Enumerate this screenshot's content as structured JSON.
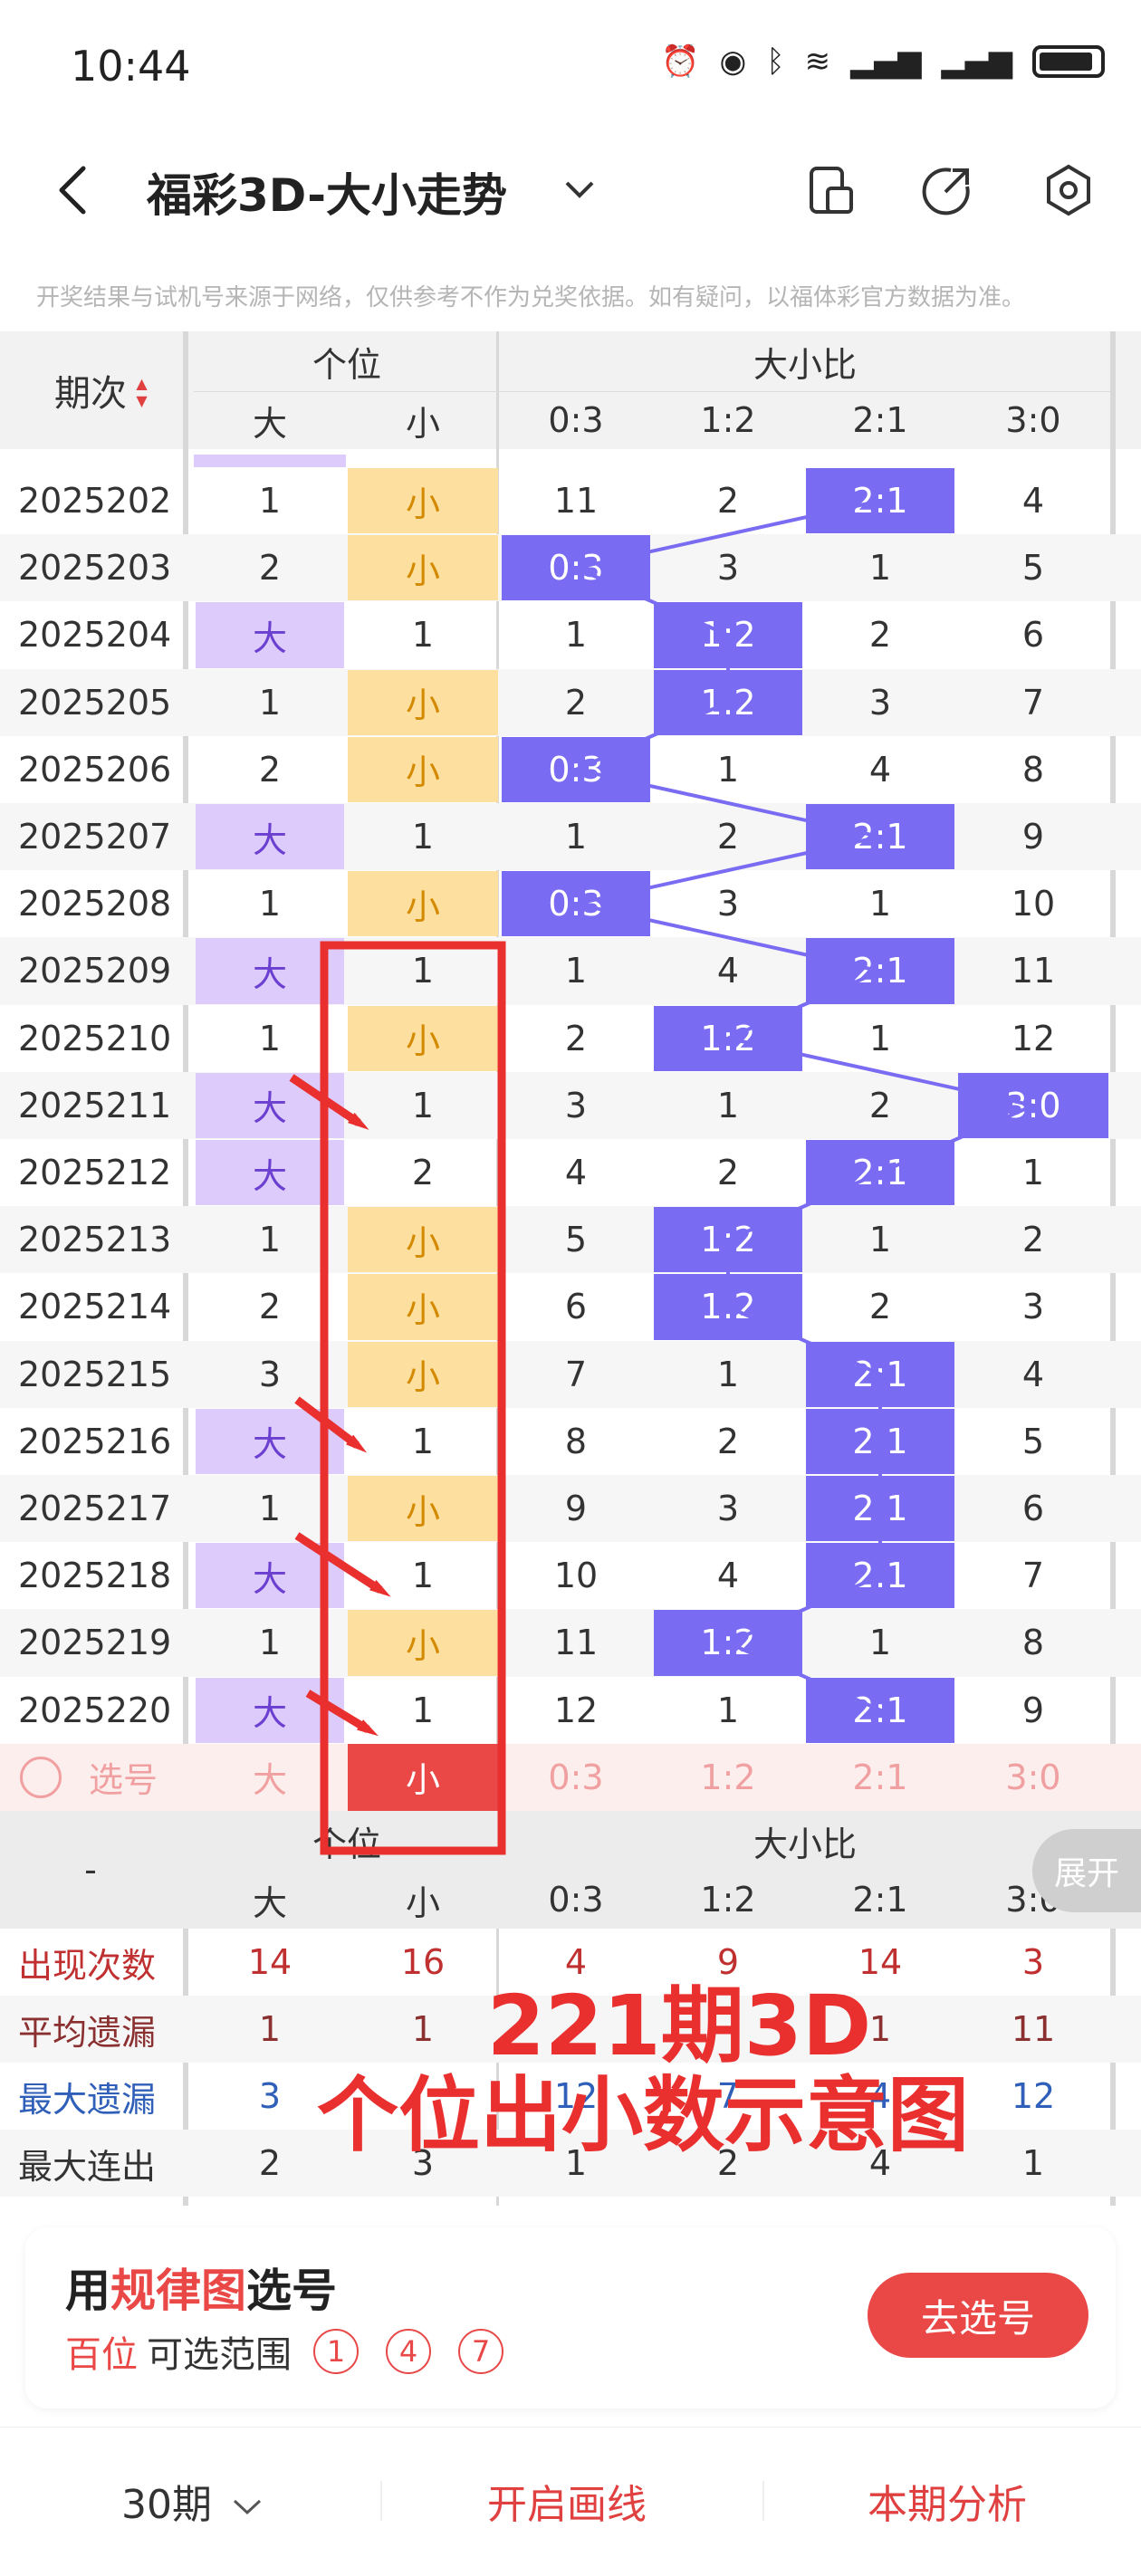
{
  "status_bar": {
    "time": "10:44"
  },
  "nav": {
    "title": "福彩3D-大小走势"
  },
  "disclaimer": "开奖结果与试机号来源于网络，仅供参考不作为兑奖依据。如有疑问，以福体彩官方数据为准。",
  "table": {
    "period_header": "期次",
    "group_single": "个位",
    "group_ratio": "大小比",
    "sub_headers": [
      "大",
      "小",
      "0:3",
      "1:2",
      "2:1",
      "3:0"
    ],
    "rows": [
      {
        "period": "2025202",
        "big": "1",
        "small": "小",
        "r03": "11",
        "r12": "2",
        "r21": "2:1",
        "r30": "4",
        "hit": "small",
        "ratio_hit": "r21"
      },
      {
        "period": "2025203",
        "big": "2",
        "small": "小",
        "r03": "0:3",
        "r12": "3",
        "r21": "1",
        "r30": "5",
        "hit": "small",
        "ratio_hit": "r03"
      },
      {
        "period": "2025204",
        "big": "大",
        "small": "1",
        "r03": "1",
        "r12": "1:2",
        "r21": "2",
        "r30": "6",
        "hit": "big",
        "ratio_hit": "r12"
      },
      {
        "period": "2025205",
        "big": "1",
        "small": "小",
        "r03": "2",
        "r12": "1:2",
        "r21": "3",
        "r30": "7",
        "hit": "small",
        "ratio_hit": "r12"
      },
      {
        "period": "2025206",
        "big": "2",
        "small": "小",
        "r03": "0:3",
        "r12": "1",
        "r21": "4",
        "r30": "8",
        "hit": "small",
        "ratio_hit": "r03"
      },
      {
        "period": "2025207",
        "big": "大",
        "small": "1",
        "r03": "1",
        "r12": "2",
        "r21": "2:1",
        "r30": "9",
        "hit": "big",
        "ratio_hit": "r21"
      },
      {
        "period": "2025208",
        "big": "1",
        "small": "小",
        "r03": "0:3",
        "r12": "3",
        "r21": "1",
        "r30": "10",
        "hit": "small",
        "ratio_hit": "r03"
      },
      {
        "period": "2025209",
        "big": "大",
        "small": "1",
        "r03": "1",
        "r12": "4",
        "r21": "2:1",
        "r30": "11",
        "hit": "big",
        "ratio_hit": "r21"
      },
      {
        "period": "2025210",
        "big": "1",
        "small": "小",
        "r03": "2",
        "r12": "1:2",
        "r21": "1",
        "r30": "12",
        "hit": "small",
        "ratio_hit": "r12"
      },
      {
        "period": "2025211",
        "big": "大",
        "small": "1",
        "r03": "3",
        "r12": "1",
        "r21": "2",
        "r30": "3:0",
        "hit": "big",
        "ratio_hit": "r30"
      },
      {
        "period": "2025212",
        "big": "大",
        "small": "2",
        "r03": "4",
        "r12": "2",
        "r21": "2:1",
        "r30": "1",
        "hit": "big",
        "ratio_hit": "r21"
      },
      {
        "period": "2025213",
        "big": "1",
        "small": "小",
        "r03": "5",
        "r12": "1:2",
        "r21": "1",
        "r30": "2",
        "hit": "small",
        "ratio_hit": "r12"
      },
      {
        "period": "2025214",
        "big": "2",
        "small": "小",
        "r03": "6",
        "r12": "1:2",
        "r21": "2",
        "r30": "3",
        "hit": "small",
        "ratio_hit": "r12"
      },
      {
        "period": "2025215",
        "big": "3",
        "small": "小",
        "r03": "7",
        "r12": "1",
        "r21": "2:1",
        "r30": "4",
        "hit": "small",
        "ratio_hit": "r21"
      },
      {
        "period": "2025216",
        "big": "大",
        "small": "1",
        "r03": "8",
        "r12": "2",
        "r21": "2:1",
        "r30": "5",
        "hit": "big",
        "ratio_hit": "r21"
      },
      {
        "period": "2025217",
        "big": "1",
        "small": "小",
        "r03": "9",
        "r12": "3",
        "r21": "2:1",
        "r30": "6",
        "hit": "small",
        "ratio_hit": "r21"
      },
      {
        "period": "2025218",
        "big": "大",
        "small": "1",
        "r03": "10",
        "r12": "4",
        "r21": "2:1",
        "r30": "7",
        "hit": "big",
        "ratio_hit": "r21"
      },
      {
        "period": "2025219",
        "big": "1",
        "small": "小",
        "r03": "11",
        "r12": "1:2",
        "r21": "1",
        "r30": "8",
        "hit": "small",
        "ratio_hit": "r12"
      },
      {
        "period": "2025220",
        "big": "大",
        "small": "1",
        "r03": "12",
        "r12": "1",
        "r21": "2:1",
        "r30": "9",
        "hit": "big",
        "ratio_hit": "r21"
      }
    ],
    "pick_row": {
      "label": "选号",
      "big": "大",
      "small": "小",
      "r03": "0:3",
      "r12": "1:2",
      "r21": "2:1",
      "r30": "3:0"
    },
    "stats_header_dash": "-",
    "stats": [
      {
        "label": "出现次数",
        "values": [
          "14",
          "16",
          "4",
          "9",
          "14",
          "3"
        ],
        "color": "#c03030"
      },
      {
        "label": "平均遗漏",
        "values": [
          "1",
          "1",
          "",
          "",
          "1",
          "11"
        ],
        "color": "#8a3030"
      },
      {
        "label": "最大遗漏",
        "values": [
          "3",
          "",
          "12",
          "7",
          "4",
          "12"
        ],
        "color": "#2f5fb8"
      },
      {
        "label": "最大连出",
        "values": [
          "2",
          "3",
          "1",
          "2",
          "4",
          "1"
        ],
        "color": "#333333"
      }
    ],
    "expand_label": "展开"
  },
  "overlay": {
    "line1": "221期3D",
    "line2": "个位出小数示意图"
  },
  "panel": {
    "title_pre": "用",
    "title_red": "规律图",
    "title_post": "选号",
    "sub_red": "百位",
    "sub_text": "可选范围",
    "numbers": [
      "1",
      "4",
      "7"
    ],
    "go_button": "去选号"
  },
  "footer": {
    "periods": "30期",
    "draw_line": "开启画线",
    "analysis": "本期分析"
  },
  "colors": {
    "accent_red": "#ea4747",
    "hit_purple": "#7a6cf2",
    "big_lavender": "#dccbfb",
    "small_yellow": "#fde0a0"
  }
}
